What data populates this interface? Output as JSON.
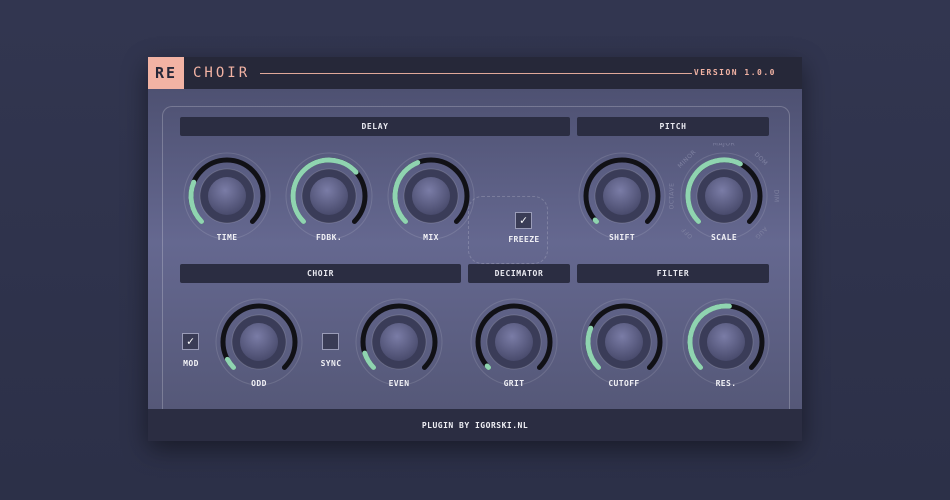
{
  "header": {
    "logo": "RE",
    "title": "CHOIR",
    "version": "VERSION 1.0.0"
  },
  "sections": {
    "delay": "DELAY",
    "pitch": "PITCH",
    "choir": "CHOIR",
    "decimator": "DECIMATOR",
    "filter": "FILTER"
  },
  "knobs": {
    "time": {
      "label": "TIME",
      "value": 0.25
    },
    "feedback": {
      "label": "FDBK.",
      "value": 0.68
    },
    "mix": {
      "label": "MIX",
      "value": 0.42
    },
    "shift": {
      "label": "SHIFT",
      "value": 0.0
    },
    "scale": {
      "label": "SCALE",
      "value": 0.6
    },
    "odd": {
      "label": "ODD",
      "value": 0.06
    },
    "even": {
      "label": "EVEN",
      "value": 0.1
    },
    "grit": {
      "label": "GRIT",
      "value": 0.0
    },
    "cutoff": {
      "label": "CUTOFF",
      "value": 0.25
    },
    "res": {
      "label": "RES.",
      "value": 0.52
    }
  },
  "toggles": {
    "freeze": {
      "label": "FREEZE",
      "checked": true,
      "mark": "✓"
    },
    "mod": {
      "label": "MOD",
      "checked": true,
      "mark": "✓"
    },
    "sync": {
      "label": "SYNC",
      "checked": false,
      "mark": ""
    }
  },
  "scale_notes": [
    "OFF",
    "OCTAVE",
    "MINOR",
    "MAJOR",
    "DOM",
    "DIM",
    "AUG"
  ],
  "footer": {
    "credit": "PLUGIN BY IGORSKI.NL"
  },
  "colors": {
    "accent": "#f2b3a4",
    "arc_active": "#8fd4b0",
    "arc_track": "#111116",
    "panel_dark": "#2b2d42"
  }
}
